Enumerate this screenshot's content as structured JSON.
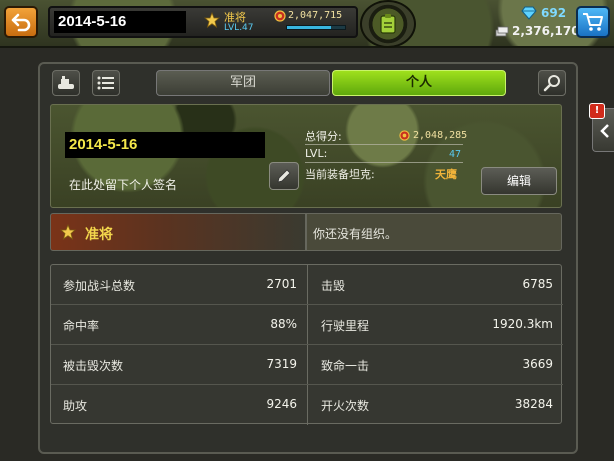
{
  "header": {
    "player_name": "2014-5-16",
    "rank_title": "准将",
    "rank_level": "LVL.47",
    "score": "2,047,715",
    "score_progress": 0.75,
    "diamonds": "692",
    "coins": "2,376,170"
  },
  "tabs": [
    {
      "label": "军团",
      "active": false
    },
    {
      "label": "个人",
      "active": true
    }
  ],
  "profile": {
    "name": "2014-5-16",
    "signature": "在此处留下个人签名",
    "total_score_label": "总得分:",
    "total_score_value": "2,048,285",
    "level_label": "LVL:",
    "level_value": "47",
    "tank_label": "当前装备坦克:",
    "tank_value": "天鹰",
    "edit_label": "编辑"
  },
  "rank_row": {
    "rank": "准将",
    "organization": "你还没有组织。"
  },
  "stats": [
    {
      "left_label": "参加战斗总数",
      "left_value": "2701",
      "right_label": "击毁",
      "right_value": "6785"
    },
    {
      "left_label": "命中率",
      "left_value": "88%",
      "right_label": "行驶里程",
      "right_value": "1920.3km"
    },
    {
      "left_label": "被击毁次数",
      "left_value": "7319",
      "right_label": "致命一击",
      "right_value": "3669"
    },
    {
      "left_label": "助攻",
      "left_value": "9246",
      "right_label": "开火次数",
      "right_value": "38284"
    }
  ],
  "side": {
    "badge": "!"
  },
  "colors": {
    "accent_green": "#8ed11a",
    "back_orange": "#e08a22",
    "shop_blue": "#2d8ee0",
    "gold": "#f2d64c"
  },
  "icons": [
    "back-arrow-icon",
    "star-icon",
    "medal-icon",
    "mission-icon",
    "diamond-icon",
    "coin-icon",
    "cart-icon",
    "tank-icon",
    "list-icon",
    "search-icon",
    "pencil-icon",
    "chevron-left-icon"
  ]
}
